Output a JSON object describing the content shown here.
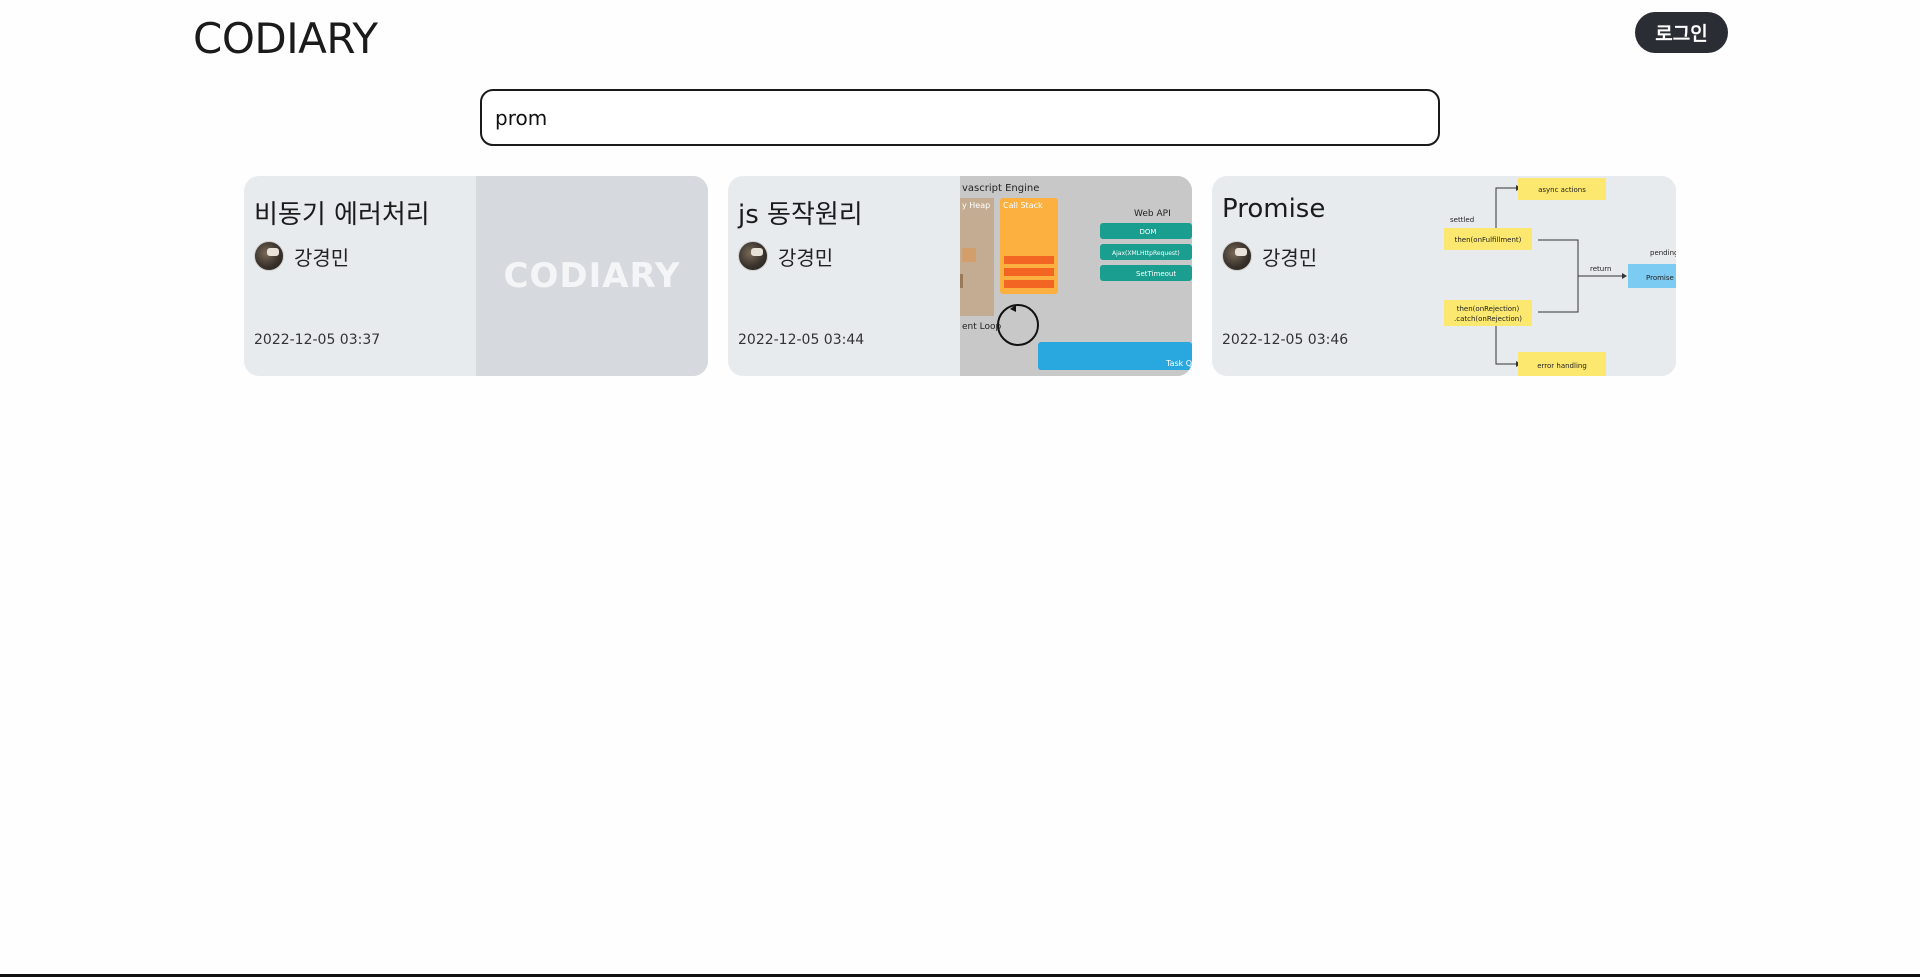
{
  "header": {
    "logo": "CODIARY",
    "login_label": "로그인"
  },
  "search": {
    "value": "prom",
    "placeholder": ""
  },
  "cards": [
    {
      "title": "비동기 에러처리",
      "author": "강경민",
      "date": "2022-12-05 03:37",
      "thumbnail_text": "CODIARY"
    },
    {
      "title": "js 동작원리",
      "author": "강경민",
      "date": "2022-12-05 03:44",
      "thumbnail_labels": {
        "engine": "vascript Engine",
        "heap": "y Heap",
        "stack": "Call Stack",
        "webapi": "Web API",
        "dom": "DOM",
        "ajax": "Ajax(XMLHttpRequest)",
        "timeout": "SetTimeout",
        "loop": "ent Loop",
        "task": "Task Q"
      }
    },
    {
      "title": "Promise",
      "author": "강경민",
      "date": "2022-12-05 03:46",
      "thumbnail_labels": {
        "async": "async actions",
        "settled": "settled",
        "fulfill": "then(onFulfillment)",
        "reject1": "then(onRejection)",
        "reject2": ".catch(onRejection)",
        "return": "return",
        "pending": "pending",
        "promise": "Promise",
        "error": "error handling"
      }
    }
  ],
  "colors": {
    "card_bg": "#e8ebee",
    "login_bg": "#2a2d33",
    "call_stack": "#fbb040",
    "web_api": "#1a9e8f",
    "task_queue": "#29a8e0",
    "promise_box": "#7ccbf3",
    "sticky_yellow": "#fde86f"
  }
}
